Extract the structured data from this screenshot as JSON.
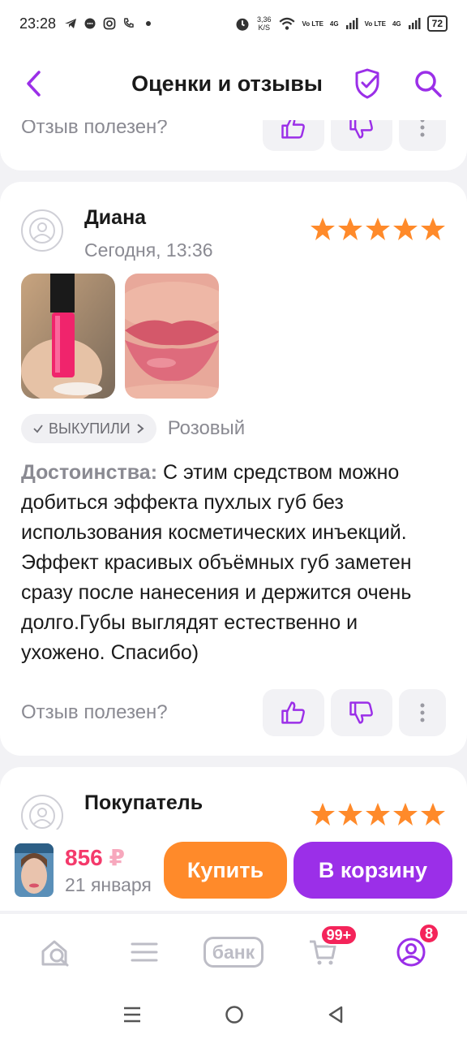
{
  "status_bar": {
    "time": "23:28",
    "net_speed_value": "3,36",
    "net_speed_unit": "K/S",
    "sim1": "Vo LTE",
    "sim2": "Vo LTE",
    "net1": "4G",
    "net2": "4G",
    "battery": "72"
  },
  "header": {
    "title": "Оценки и отзывы"
  },
  "prev_review": {
    "helpful_label": "Отзыв полезен?"
  },
  "review": {
    "author": "Диана",
    "date": "Сегодня, 13:36",
    "rating": 5,
    "bought_tag": "ВЫКУПИЛИ",
    "variant": "Розовый",
    "pros_label": "Достоинства:",
    "pros_text": " С этим средством можно добиться эффекта пухлых губ без использования косметических инъекций. Эффект красивых объёмных губ  заметен сразу после нанесения и держится очень долго.Губы выглядят естественно и ухожено. Спасибо)",
    "helpful_label": "Отзыв полезен?"
  },
  "next_review": {
    "author": "Покупатель",
    "rating": 5
  },
  "buy_bar": {
    "price": "856",
    "currency": "₽",
    "delivery": "21 января",
    "buy_label": "Купить",
    "cart_label": "В корзину"
  },
  "tabs": {
    "bank_label": "банк",
    "cart_badge": "99+",
    "profile_badge": "8"
  },
  "colors": {
    "accent": "#9b2fe8",
    "star": "#ff8a2a",
    "buy": "#ff8a2a",
    "price": "#f43a6b"
  }
}
